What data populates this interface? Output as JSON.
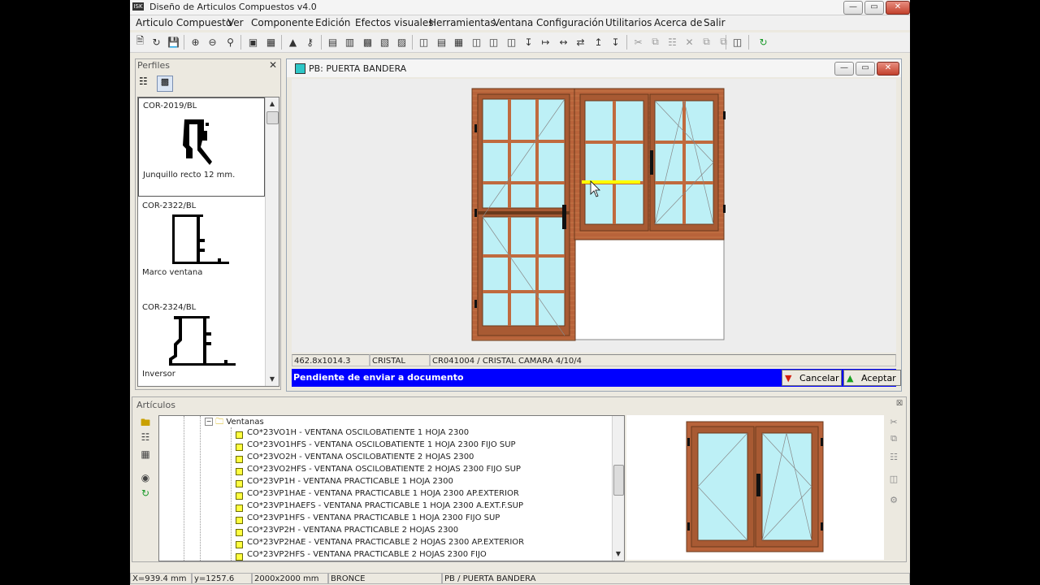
{
  "app": {
    "title": "Diseño de Articulos Compuestos v4.0",
    "icon_label": "ISK"
  },
  "menu": [
    "Articulo Compuesto",
    "Ver",
    "Componente",
    "Edición",
    "Efectos visuales",
    "Herramientas",
    "Ventana",
    "Configuración",
    "Utilitarios",
    "Acerca de",
    "Salir"
  ],
  "perfiles": {
    "header": "Perfiles",
    "items": [
      {
        "code": "COR-2019/BL",
        "desc": "Junquillo recto 12 mm."
      },
      {
        "code": "COR-2322/BL",
        "desc": "Marco ventana"
      },
      {
        "code": "COR-2324/BL",
        "desc": "Inversor"
      }
    ]
  },
  "editor": {
    "title": "PB: PUERTA BANDERA",
    "status": {
      "dims": "462.8x1014.3 mm",
      "material": "CRISTAL",
      "glass": "CR041004 / CRISTAL CAMARA 4/10/4"
    },
    "message": "Pendiente de enviar a documento",
    "cancel_label": "Cancelar",
    "accept_label": "Aceptar"
  },
  "articulos": {
    "header": "Artículos",
    "folder": "Ventanas",
    "items": [
      "CO*23VO1H - VENTANA OSCILOBATIENTE 1 HOJA 2300",
      "CO*23VO1HFS - VENTANA OSCILOBATIENTE 1 HOJA 2300 FIJO SUP",
      "CO*23VO2H - VENTANA OSCILOBATIENTE 2 HOJAS 2300",
      "CO*23VO2HFS - VENTANA OSCILOBATIENTE 2 HOJAS 2300 FIJO SUP",
      "CO*23VP1H - VENTANA PRACTICABLE 1 HOJA 2300",
      "CO*23VP1HAE - VENTANA PRACTICABLE 1 HOJA 2300 AP.EXTERIOR",
      "CO*23VP1HAEFS - VENTANA PRACTICABLE 1 HOJA 2300 A.EXT.F.SUP",
      "CO*23VP1HFS - VENTANA PRACTICABLE 1 HOJA 2300 FIJO SUP",
      "CO*23VP2H - VENTANA PRACTICABLE 2 HOJAS 2300",
      "CO*23VP2HAE - VENTANA PRACTICABLE 2 HOJAS 2300 AP.EXTERIOR",
      "CO*23VP2HFS - VENTANA PRACTICABLE 2 HOJAS 2300 FIJO"
    ]
  },
  "statusbar": {
    "x": "X=939.4 mm",
    "y": "y=1257.6 mm",
    "size": "2000x2000 mm",
    "color": "BRONCE",
    "article": "PB / PUERTA BANDERA"
  },
  "colors": {
    "frame": "#b8633a",
    "glass": "#bdf0f6",
    "selection": "#ffff00",
    "message_bar": "#0000ff"
  }
}
